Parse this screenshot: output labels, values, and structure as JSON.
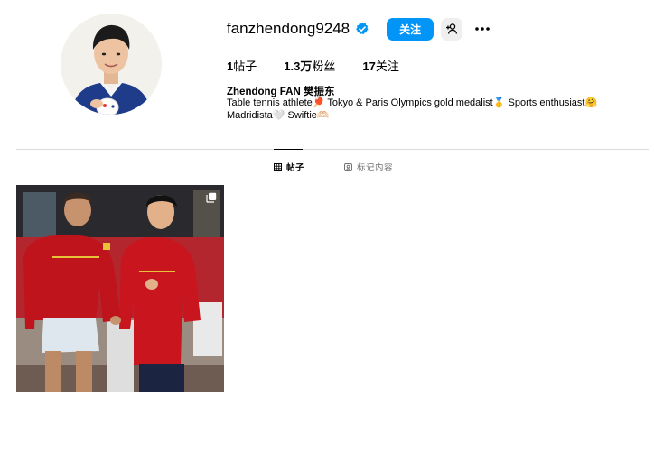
{
  "profile": {
    "username": "fanzhendong9248",
    "follow_label": "关注",
    "full_name": "Zhendong FAN 樊振东",
    "bio_line1": "Table tennis athlete🏓 Tokyo & Paris Olympics gold medalist🥇 Sports enthusiast🤗",
    "bio_line2": "Madridista🤍 Swiftie🫶🏻"
  },
  "stats": {
    "posts_count": "1",
    "posts_label": "帖子",
    "followers_count": "1.3万",
    "followers_label": "粉丝",
    "following_count": "17",
    "following_label": "关注"
  },
  "tabs": [
    {
      "label": "帖子",
      "icon": "grid-icon",
      "active": true
    },
    {
      "label": "标记内容",
      "icon": "tagged-icon",
      "active": false
    }
  ],
  "colors": {
    "accent": "#0095f6",
    "verified": "#0095f6",
    "divider": "#dbdbdb",
    "muted_text": "#737373"
  },
  "posts": [
    {
      "icon": "multi-photo-icon",
      "count": 1
    }
  ]
}
